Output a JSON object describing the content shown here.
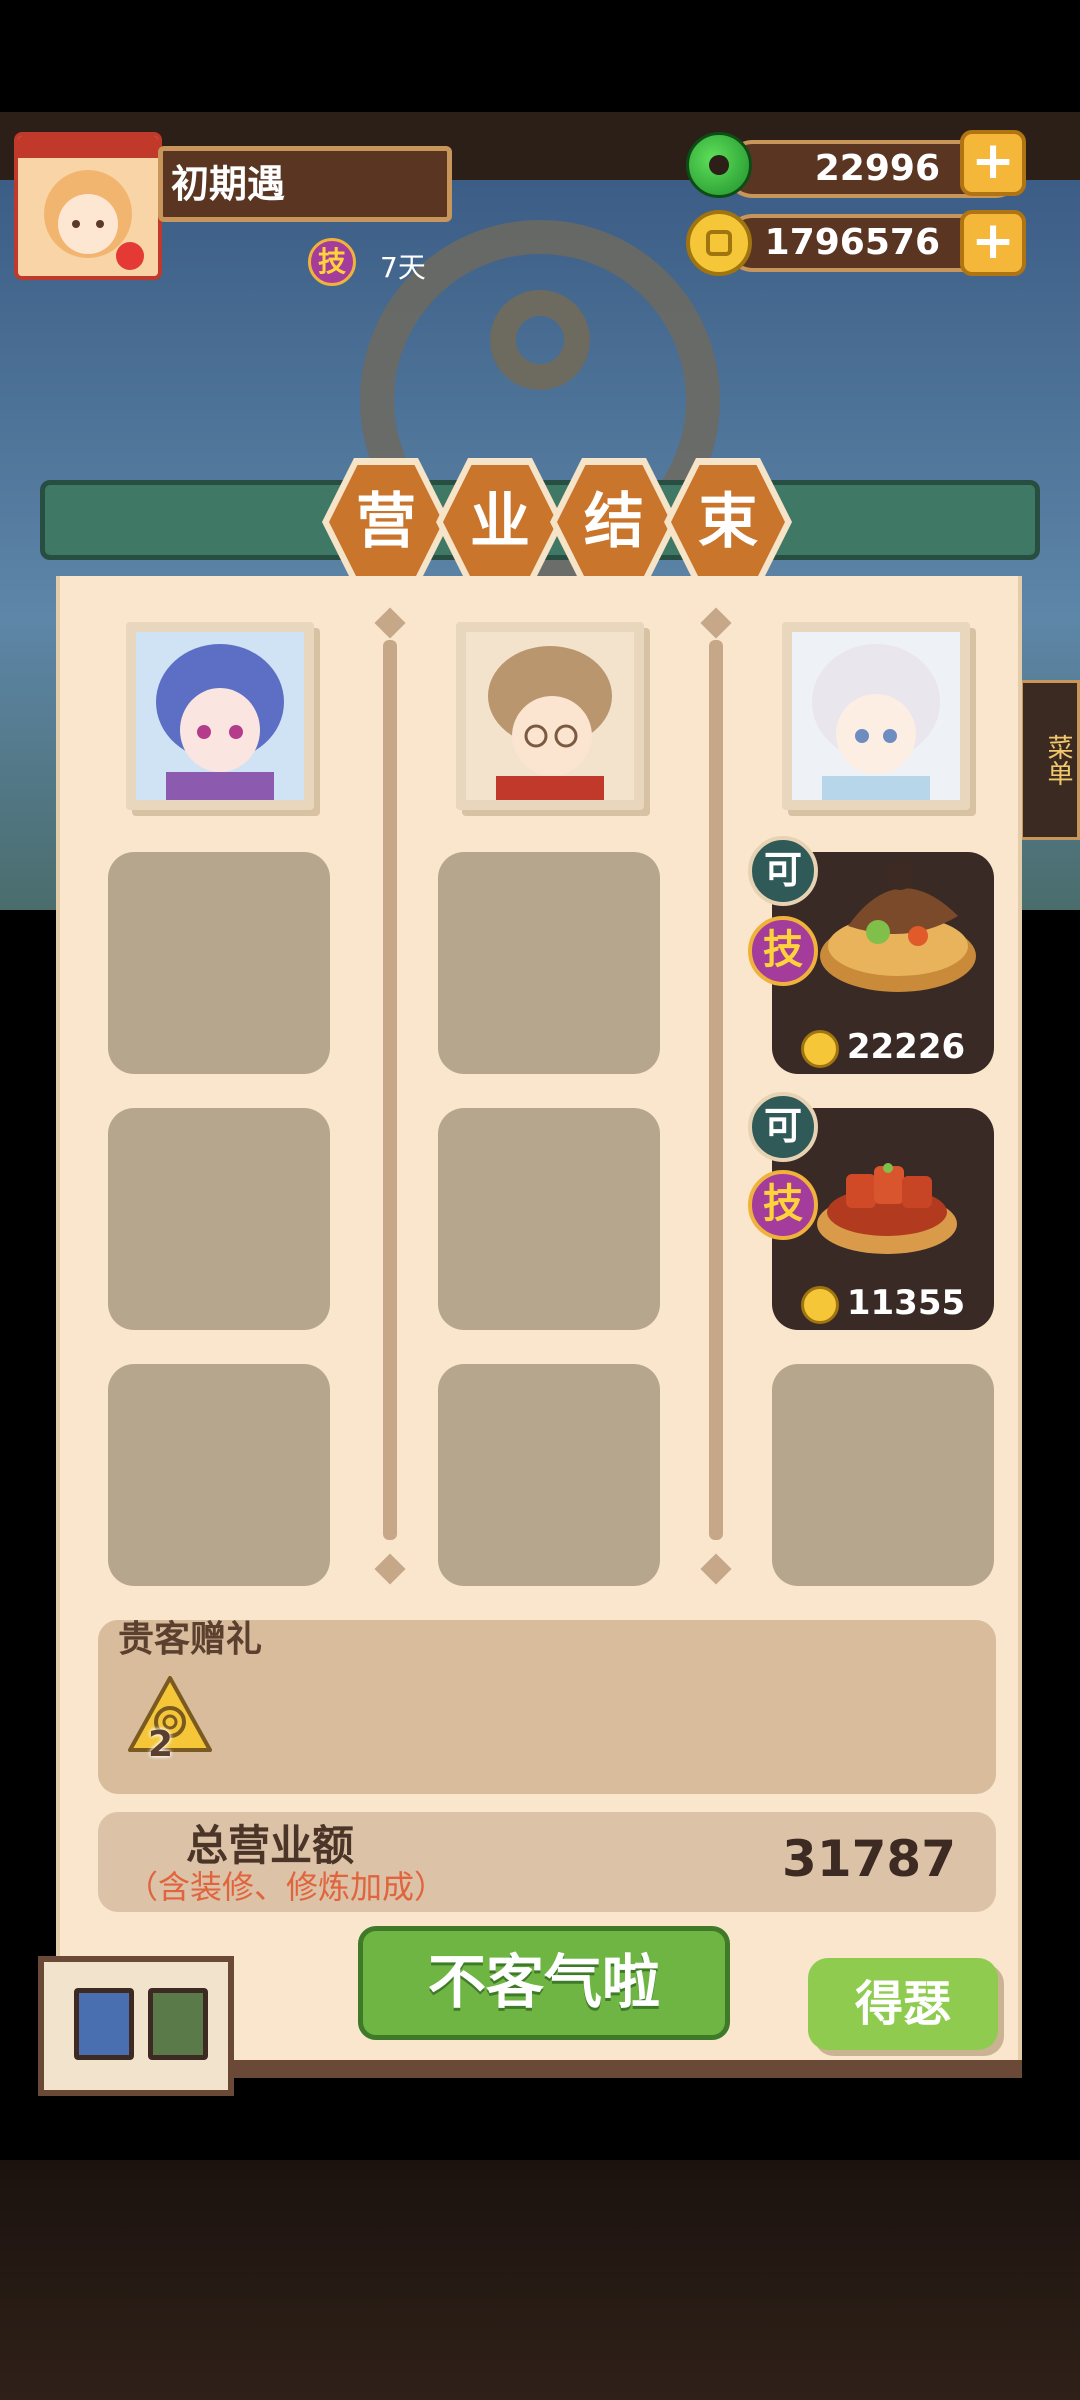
{
  "player": {
    "name": "初期遇",
    "skill_badge": "技",
    "skill_days": "7天"
  },
  "currencies": {
    "jade": "22996",
    "coins": "1796576",
    "plus_label": "+"
  },
  "title_chars": [
    "营",
    "业",
    "结",
    "束"
  ],
  "dishes": [
    {
      "can_label": "可",
      "skill_label": "技",
      "price": "22226"
    },
    {
      "can_label": "可",
      "skill_label": "技",
      "price": "11355"
    }
  ],
  "gift": {
    "title": "贵客赠礼",
    "count": "2"
  },
  "revenue": {
    "title": "总营业额",
    "subtitle": "（含装修、修炼加成）",
    "value": "31787"
  },
  "buttons": {
    "main": "不客气啦",
    "side": "得瑟"
  },
  "side_menu": "菜单",
  "colors": {
    "panel": "#f9e6cc",
    "accent_orange": "#c9762c",
    "green_button": "#6fb544",
    "skill_purple": "#a33c9b"
  }
}
